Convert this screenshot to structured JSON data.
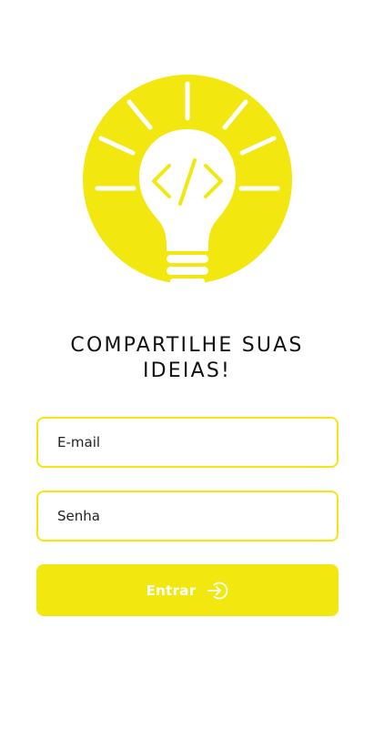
{
  "headline": {
    "line1": "COMPARTILHE SUAS",
    "line2": "IDEIAS!"
  },
  "login_form": {
    "email_placeholder": "E-mail",
    "password_placeholder": "Senha",
    "submit_label": "Entrar"
  },
  "icons": {
    "logo": "lightbulb-code-icon",
    "submit": "sign-in-arrow-icon"
  },
  "colors": {
    "accent": "#f2e80f",
    "text": "#111111",
    "background": "#ffffff"
  }
}
